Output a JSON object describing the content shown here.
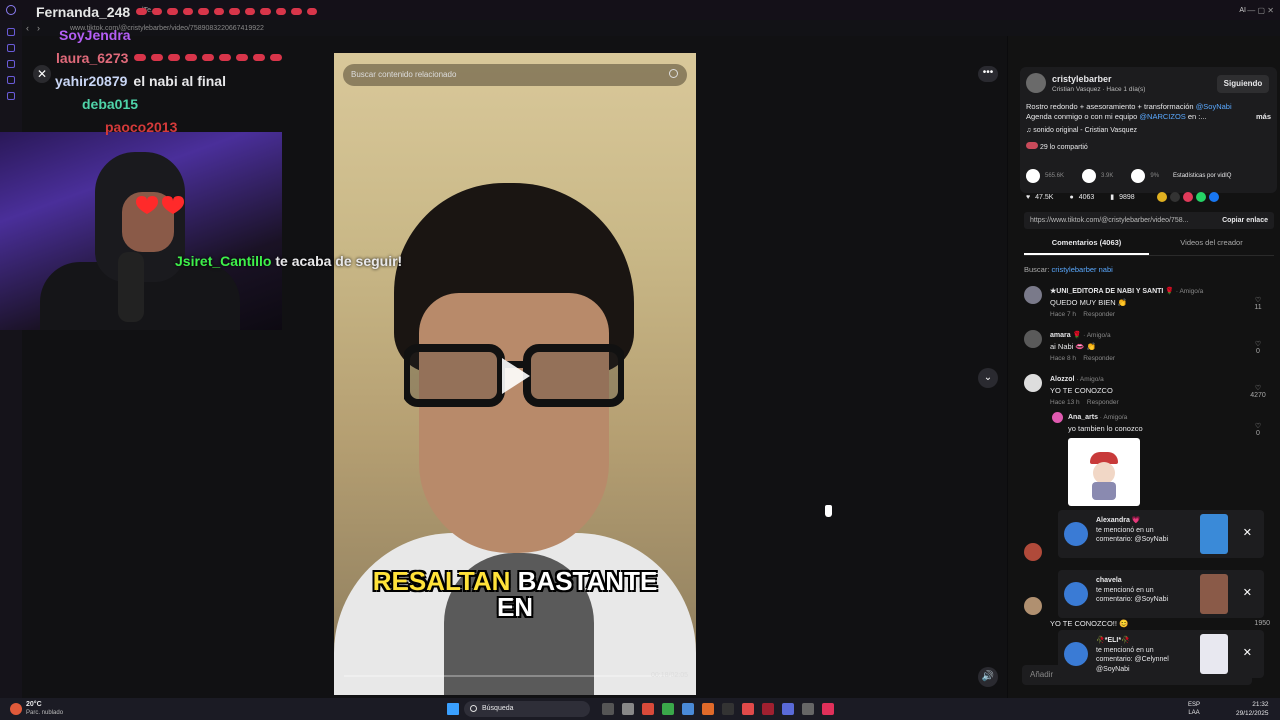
{
  "browser": {
    "url": "www.tiktok.com/@cristylebarber/video/7589083220667419922",
    "tab_title": "...|Te..",
    "ai_label": "AI"
  },
  "stream_chat": {
    "messages": [
      {
        "user": "Fernanda_248",
        "color": "#e6e6e6",
        "text": "",
        "emotes": 12
      },
      {
        "user": "SoyJendra",
        "color": "#b45ef5",
        "text": "",
        "emotes": 0
      },
      {
        "user": "laura_6273",
        "color": "#e06a7a",
        "text": "",
        "emotes": 9
      },
      {
        "user": "yahir20879",
        "color": "#c9d6f5",
        "text": "el nabi al final",
        "emotes": 0
      },
      {
        "user": "deba015",
        "color": "#4fd4a9",
        "text": "",
        "emotes": 0
      },
      {
        "user": "paoco2013",
        "color": "#d43a3a",
        "text": "",
        "emotes": 0
      }
    ]
  },
  "follow_alert": {
    "username": "Jsiret_Cantillo",
    "text": "te acaba de seguir!"
  },
  "video": {
    "search_placeholder": "Buscar contenido relacionado",
    "caption_highlight": "RESALTAN",
    "caption_rest": "BASTANTE",
    "caption_line2": "EN",
    "time": "00:18/02:05"
  },
  "post": {
    "author": "cristylebarber",
    "author_sub": "Cristian Vasquez · Hace 1 día(s)",
    "follow_label": "Siguiendo",
    "desc_line1": "Rostro redondo + asesoramiento + transformación ",
    "desc_mention1": "@SoyNabi",
    "desc_line2": "Agenda conmigo o con mi equipo ",
    "desc_mention2": "@NARCIZOS",
    "desc_line2_end": " en :...",
    "more_label": "más",
    "sound": "sonido original - Cristian Vasquez",
    "shared": "29 lo compartió",
    "plays": "565.6K",
    "shares_count": "3.9K",
    "stats_pct": "9%",
    "stats_label": "Estadísticas por vidIQ",
    "likes": "47.5K",
    "comments": "4063",
    "saves": "9898",
    "link": "https://www.tiktok.com/@cristylebarber/video/758...",
    "copy_label": "Copiar enlace"
  },
  "tabs": [
    {
      "label": "Comentarios (4063)",
      "active": true
    },
    {
      "label": "Videos del creador",
      "active": false
    }
  ],
  "search_line": {
    "label": "Buscar:",
    "query": "cristylebarber nabi"
  },
  "comments": [
    {
      "user": "★UNI_EDITORA DE NABI Y SANTI 🌹",
      "tag": " · Amigo/a",
      "text": "QUEDO MUY BIEN 👏",
      "time": "Hace 7 h",
      "reply": "Responder",
      "likes": "11"
    },
    {
      "user": "amara 🌹",
      "tag": " · Amigo/a",
      "text": "ai Nabi 👄 👏",
      "time": "Hace 8 h",
      "reply": "Responder",
      "likes": "0"
    },
    {
      "user": "Alozzol",
      "tag": " · Amigo/a",
      "text": "YO TE CONOZCO",
      "time": "Hace 13 h",
      "reply": "Responder",
      "likes": "4270"
    },
    {
      "user": "Ana_arts",
      "tag": " · Amigo/a",
      "text": "yo tambien lo conozco",
      "time": "",
      "reply": "",
      "likes": "0"
    }
  ],
  "partial_comment": {
    "text": "YO TE CONOZCO!! 😊",
    "likes": "1950"
  },
  "notifications": [
    {
      "user": "Alexandra 💗",
      "line1": "te mencionó en un",
      "line2": "comentario: @SoyNabi"
    },
    {
      "user": "chavela",
      "line1": "te mencionó en un",
      "line2": "comentario: @SoyNabi"
    },
    {
      "user": "🥀*ELI*🥀",
      "line1": "te mencionó en un",
      "line2": "comentario: @Celynnel @SoyNabi"
    }
  ],
  "add_comment_placeholder": "Añadir",
  "taskbar": {
    "temp": "20°C",
    "weather": "Parc. nublado",
    "search": "Búsqueda",
    "lang1": "ESP",
    "lang2": "LAA",
    "time": "21:32",
    "date": "29/12/2025"
  }
}
